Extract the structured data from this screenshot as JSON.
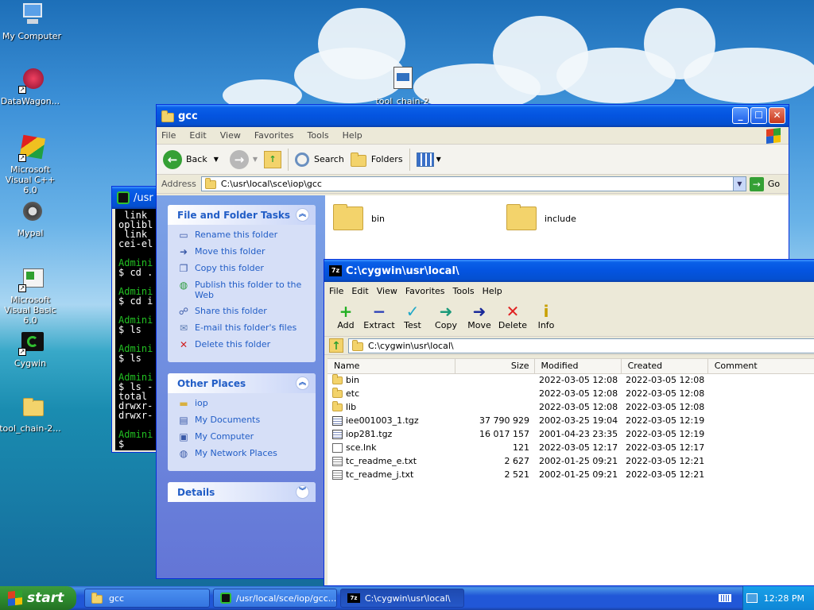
{
  "desktop": {
    "icons": [
      {
        "label": "My Computer"
      },
      {
        "label": "DataWagon..."
      },
      {
        "label": "Microsoft Visual C++ 6.0"
      },
      {
        "label": "Mypal"
      },
      {
        "label": "Microsoft Visual Basic 6.0"
      },
      {
        "label": "Cygwin"
      },
      {
        "label": "tool_chain-2..."
      },
      {
        "label": "tool_chain-2"
      }
    ]
  },
  "cygwin": {
    "title": "/usr",
    "lines": [
      {
        "text": " link",
        "color": "#ffffff"
      },
      {
        "text": "oplibl",
        "color": "#ffffff"
      },
      {
        "text": " link",
        "color": "#ffffff"
      },
      {
        "text": "cei-el",
        "color": "#ffffff"
      },
      {
        "text": "",
        "color": "#ffffff"
      },
      {
        "text": "Admini",
        "color": "#22c022"
      },
      {
        "text": "$ cd .",
        "color": "#ffffff"
      },
      {
        "text": "",
        "color": "#ffffff"
      },
      {
        "text": "Admini",
        "color": "#22c022"
      },
      {
        "text": "$ cd i",
        "color": "#ffffff"
      },
      {
        "text": "",
        "color": "#ffffff"
      },
      {
        "text": "Admini",
        "color": "#22c022"
      },
      {
        "text": "$ ls",
        "color": "#ffffff"
      },
      {
        "text": "",
        "color": "#ffffff"
      },
      {
        "text": "Admini",
        "color": "#22c022"
      },
      {
        "text": "$ ls",
        "color": "#ffffff"
      },
      {
        "text": "",
        "color": "#ffffff"
      },
      {
        "text": "Admini",
        "color": "#22c022"
      },
      {
        "text": "$ ls -",
        "color": "#ffffff"
      },
      {
        "text": "total",
        "color": "#ffffff"
      },
      {
        "text": "drwxr-",
        "color": "#ffffff"
      },
      {
        "text": "drwxr-",
        "color": "#ffffff"
      },
      {
        "text": "",
        "color": "#ffffff"
      },
      {
        "text": "Admini",
        "color": "#22c022"
      },
      {
        "text": "$",
        "color": "#ffffff"
      }
    ]
  },
  "explorer": {
    "title": "gcc",
    "menu": [
      "File",
      "Edit",
      "View",
      "Favorites",
      "Tools",
      "Help"
    ],
    "toolbar": {
      "back": "Back",
      "search": "Search",
      "folders": "Folders"
    },
    "address_label": "Address",
    "address": "C:\\usr\\local\\sce\\iop\\gcc",
    "go": "Go",
    "tasks_title": "File and Folder Tasks",
    "tasks": [
      {
        "label": "Rename this folder",
        "icon": "rename-icon"
      },
      {
        "label": "Move this folder",
        "icon": "move-icon"
      },
      {
        "label": "Copy this folder",
        "icon": "copy-icon"
      },
      {
        "label": "Publish this folder to the Web",
        "icon": "globe-icon"
      },
      {
        "label": "Share this folder",
        "icon": "share-icon"
      },
      {
        "label": "E-mail this folder's files",
        "icon": "email-icon"
      },
      {
        "label": "Delete this folder",
        "icon": "delete-icon"
      }
    ],
    "places_title": "Other Places",
    "places": [
      {
        "label": "iop",
        "icon": "folder-icon"
      },
      {
        "label": "My Documents",
        "icon": "documents-icon"
      },
      {
        "label": "My Computer",
        "icon": "computer-icon"
      },
      {
        "label": "My Network Places",
        "icon": "network-icon"
      }
    ],
    "details_title": "Details",
    "folders": [
      {
        "name": "bin"
      },
      {
        "name": "include"
      }
    ]
  },
  "sevenzip": {
    "title": "C:\\cygwin\\usr\\local\\",
    "menu": [
      "File",
      "Edit",
      "View",
      "Favorites",
      "Tools",
      "Help"
    ],
    "toolbar": [
      {
        "label": "Add",
        "icon": "add-icon",
        "color": "#22b022",
        "glyph": "+"
      },
      {
        "label": "Extract",
        "icon": "extract-icon",
        "color": "#2a3fb8",
        "glyph": "−"
      },
      {
        "label": "Test",
        "icon": "test-icon",
        "color": "#20a8c8",
        "glyph": "✓"
      },
      {
        "label": "Copy",
        "icon": "copy-arrow-icon",
        "color": "#1a9a7a",
        "glyph": "➜"
      },
      {
        "label": "Move",
        "icon": "move-arrow-icon",
        "color": "#1a2a9a",
        "glyph": "➜"
      },
      {
        "label": "Delete",
        "icon": "delete-x-icon",
        "color": "#e02020",
        "glyph": "✕"
      },
      {
        "label": "Info",
        "icon": "info-icon",
        "color": "#c8a000",
        "glyph": "i"
      }
    ],
    "path": "C:\\cygwin\\usr\\local\\",
    "columns": [
      "Name",
      "Size",
      "Modified",
      "Created",
      "Comment"
    ],
    "rows": [
      {
        "name": "bin",
        "type": "folder",
        "size": "",
        "modified": "2022-03-05 12:08",
        "created": "2022-03-05 12:08"
      },
      {
        "name": "etc",
        "type": "folder",
        "size": "",
        "modified": "2022-03-05 12:08",
        "created": "2022-03-05 12:08"
      },
      {
        "name": "lib",
        "type": "folder",
        "size": "",
        "modified": "2022-03-05 12:08",
        "created": "2022-03-05 12:08"
      },
      {
        "name": "iee001003_1.tgz",
        "type": "archive",
        "size": "37 790 929",
        "modified": "2002-03-25 19:04",
        "created": "2022-03-05 12:19"
      },
      {
        "name": "iop281.tgz",
        "type": "archive",
        "size": "16 017 157",
        "modified": "2001-04-23 23:35",
        "created": "2022-03-05 12:19"
      },
      {
        "name": "sce.lnk",
        "type": "file",
        "size": "121",
        "modified": "2022-03-05 12:17",
        "created": "2022-03-05 12:17"
      },
      {
        "name": "tc_readme_e.txt",
        "type": "text",
        "size": "2 627",
        "modified": "2002-01-25 09:21",
        "created": "2022-03-05 12:21"
      },
      {
        "name": "tc_readme_j.txt",
        "type": "text",
        "size": "2 521",
        "modified": "2002-01-25 09:21",
        "created": "2022-03-05 12:21"
      }
    ]
  },
  "taskbar": {
    "start": "start",
    "tasks": [
      {
        "label": "gcc"
      },
      {
        "label": "/usr/local/sce/iop/gcc..."
      },
      {
        "label": "C:\\cygwin\\usr\\local\\"
      }
    ],
    "clock": "12:28 PM"
  }
}
